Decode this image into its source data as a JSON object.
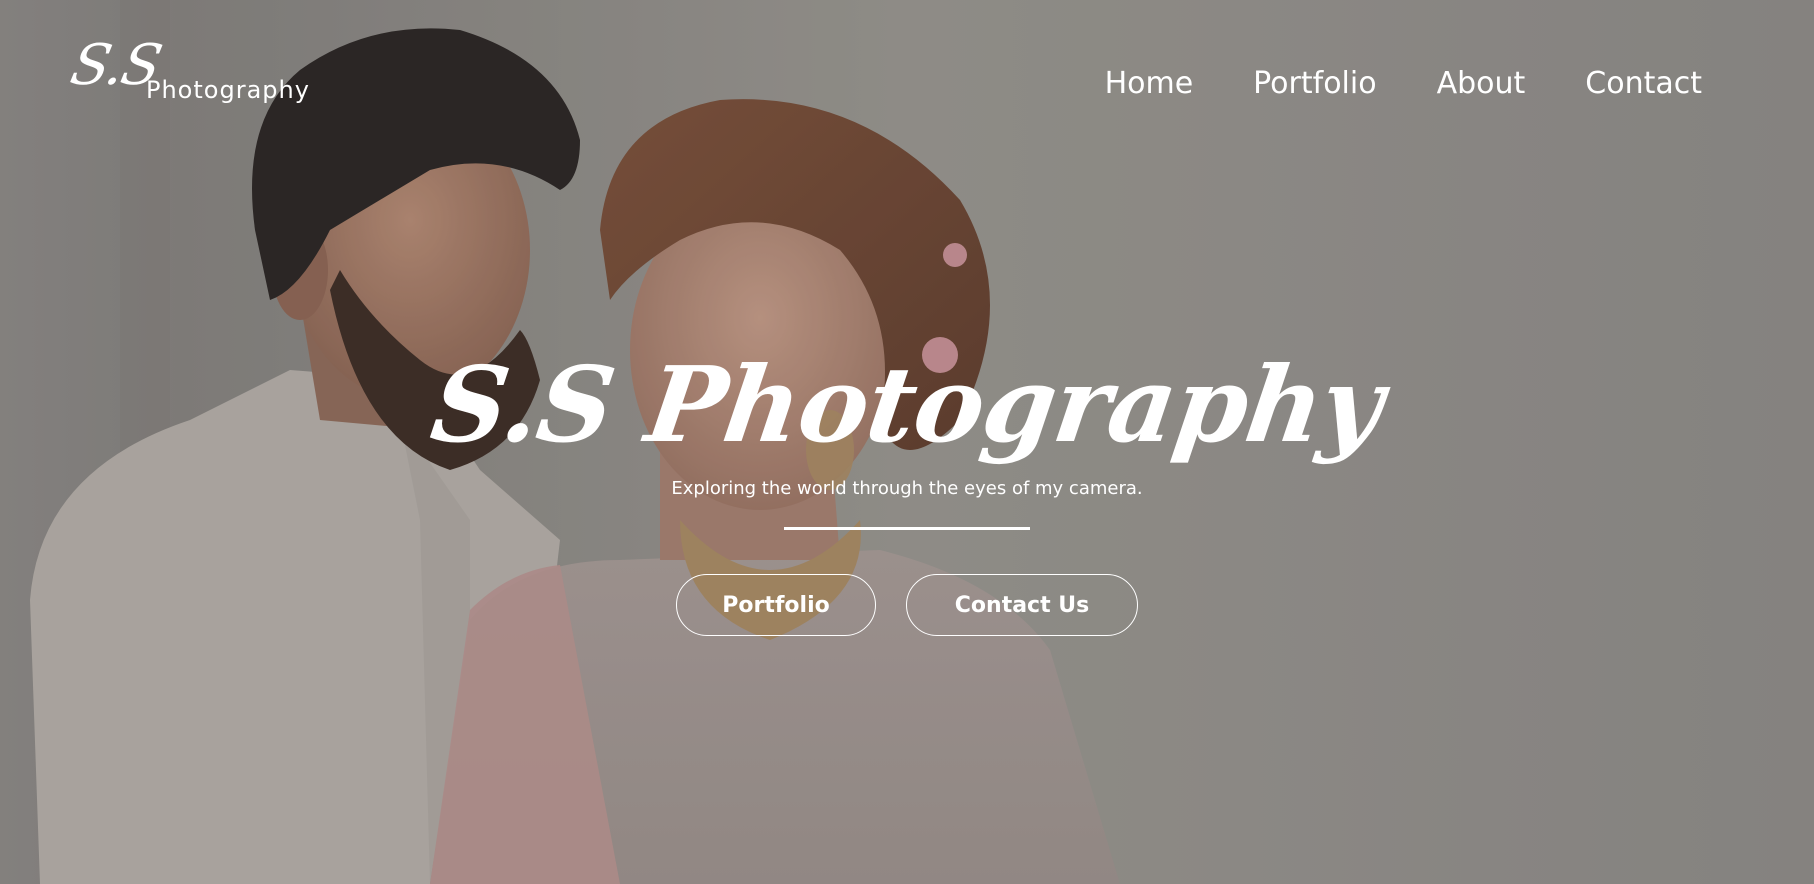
{
  "brand": {
    "logo_mark": "S.S",
    "logo_word": "Photography"
  },
  "nav": {
    "items": [
      {
        "label": "Home"
      },
      {
        "label": "Portfolio"
      },
      {
        "label": "About"
      },
      {
        "label": "Contact"
      }
    ]
  },
  "hero": {
    "title": "S.S Photography",
    "subtitle": "Exploring the world through the eyes of my camera.",
    "buttons": {
      "portfolio": "Portfolio",
      "contact": "Contact Us"
    }
  },
  "colors": {
    "text": "#ffffff",
    "overlay": "#8e8c89"
  }
}
